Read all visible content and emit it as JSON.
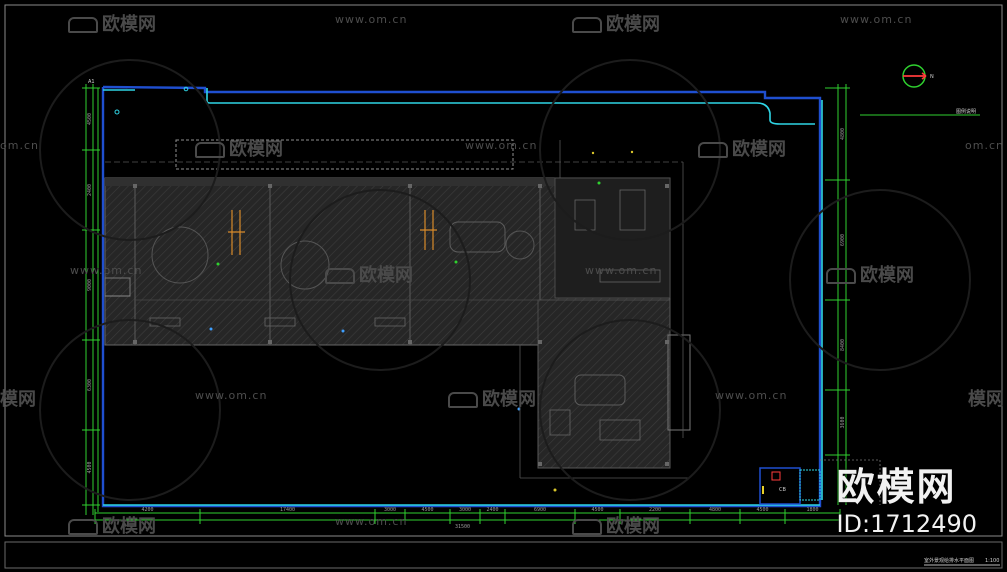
{
  "drawing": {
    "title_note": "室外景观给排水平面图",
    "scale_note": "1:100",
    "north_label": "N",
    "legend_note": "图例说明",
    "corner_tag": "A1",
    "room_tag": "CB"
  },
  "dimensions": {
    "bottom": [
      "4200",
      "17400",
      "3000",
      "4500",
      "3000",
      "2400",
      "6900",
      "4500",
      "2200",
      "4800",
      "4500",
      "1800"
    ],
    "bottom_total": "31500",
    "left": [
      "4500",
      "2400",
      "9000",
      "6300",
      "4500"
    ],
    "right": [
      "4800",
      "6900",
      "8400",
      "3600"
    ]
  },
  "watermarks": {
    "cn_text": "欧模网",
    "url_text": "www.om.cn",
    "url_fragment": "om.cn",
    "cn_fragment": "模网"
  },
  "brand": {
    "name": "欧模网",
    "id_text": "ID:1712490"
  },
  "colors": {
    "background": "#000000",
    "boundary_blue": "#1f4fd0",
    "pipe_cyan": "#2fd6e6",
    "dim_green": "#2fd12f",
    "floorplan_gray": "#2e2e2e",
    "watermark_gray": "#4a4a4a"
  }
}
